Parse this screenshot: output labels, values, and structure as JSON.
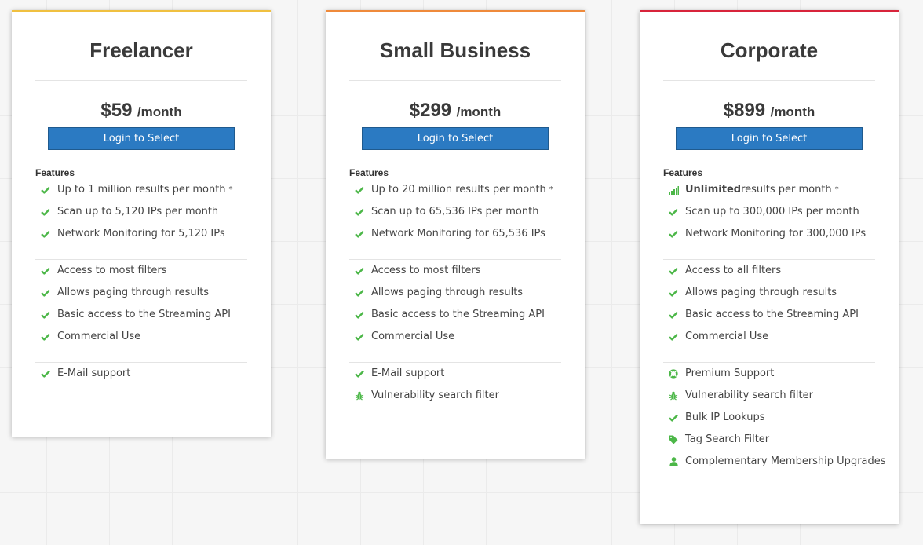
{
  "plans": [
    {
      "name": "Freelancer",
      "price": "$59",
      "period": "/month",
      "button_label": "Login to Select",
      "features_heading": "Features",
      "features": [
        {
          "icon": "check-icon",
          "pre": "",
          "strong": "",
          "text": "Up to 1 million results per month",
          "mark": "*"
        },
        {
          "icon": "check-icon",
          "pre": "",
          "strong": "",
          "text": "Scan up to 5,120 IPs per month",
          "mark": ""
        },
        {
          "icon": "check-icon",
          "pre": "",
          "strong": "",
          "text": "Network Monitoring for 5,120 IPs",
          "mark": ""
        }
      ],
      "access": [
        {
          "icon": "check-icon",
          "text": "Access to most filters"
        },
        {
          "icon": "check-icon",
          "text": "Allows paging through results"
        },
        {
          "icon": "check-icon",
          "text": "Basic access to the Streaming API"
        },
        {
          "icon": "check-icon",
          "text": "Commercial Use"
        }
      ],
      "extras": [
        {
          "icon": "check-icon",
          "text": "E-Mail support"
        }
      ]
    },
    {
      "name": "Small Business",
      "price": "$299",
      "period": "/month",
      "button_label": "Login to Select",
      "features_heading": "Features",
      "features": [
        {
          "icon": "check-icon",
          "pre": "",
          "strong": "",
          "text": "Up to 20 million results per month",
          "mark": "*"
        },
        {
          "icon": "check-icon",
          "pre": "",
          "strong": "",
          "text": "Scan up to 65,536 IPs per month",
          "mark": ""
        },
        {
          "icon": "check-icon",
          "pre": "",
          "strong": "",
          "text": "Network Monitoring for 65,536 IPs",
          "mark": ""
        }
      ],
      "access": [
        {
          "icon": "check-icon",
          "text": "Access to most filters"
        },
        {
          "icon": "check-icon",
          "text": "Allows paging through results"
        },
        {
          "icon": "check-icon",
          "text": "Basic access to the Streaming API"
        },
        {
          "icon": "check-icon",
          "text": "Commercial Use"
        }
      ],
      "extras": [
        {
          "icon": "check-icon",
          "text": "E-Mail support"
        },
        {
          "icon": "bug-icon",
          "text": "Vulnerability search filter"
        }
      ]
    },
    {
      "name": "Corporate",
      "price": "$899",
      "period": "/month",
      "button_label": "Login to Select",
      "features_heading": "Features",
      "features": [
        {
          "icon": "signal-icon",
          "pre": "",
          "strong": "Unlimited",
          "text": " results per month",
          "mark": "*"
        },
        {
          "icon": "check-icon",
          "pre": "",
          "strong": "",
          "text": "Scan up to 300,000 IPs per month",
          "mark": ""
        },
        {
          "icon": "check-icon",
          "pre": "",
          "strong": "",
          "text": "Network Monitoring for 300,000 IPs",
          "mark": ""
        }
      ],
      "access": [
        {
          "icon": "check-icon",
          "text": "Access to all filters"
        },
        {
          "icon": "check-icon",
          "text": "Allows paging through results"
        },
        {
          "icon": "check-icon",
          "text": "Basic access to the Streaming API"
        },
        {
          "icon": "check-icon",
          "text": "Commercial Use"
        }
      ],
      "extras": [
        {
          "icon": "life-ring-icon",
          "text": "Premium Support"
        },
        {
          "icon": "bug-icon",
          "text": "Vulnerability search filter"
        },
        {
          "icon": "check-icon",
          "text": "Bulk IP Lookups"
        },
        {
          "icon": "tag-icon",
          "text": "Tag Search Filter"
        },
        {
          "icon": "user-icon",
          "text": "Complementary Membership Upgrades"
        }
      ]
    }
  ],
  "colors": {
    "accent_freelancer": "#f0c040",
    "accent_small_business": "#ef8a3b",
    "accent_corporate": "#d8243b",
    "button": "#2b7ac2",
    "icon_green": "#4cb748"
  }
}
